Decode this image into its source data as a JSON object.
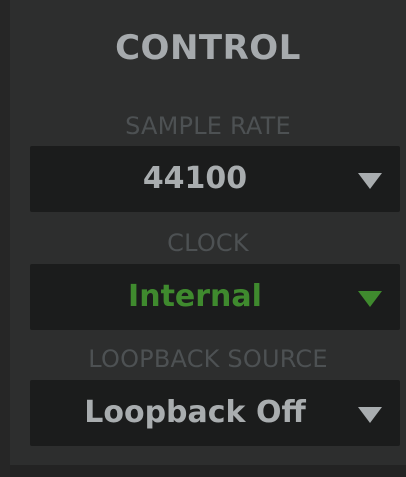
{
  "control": {
    "title": "CONTROL",
    "sample_rate": {
      "label": "SAMPLE RATE",
      "value": "44100",
      "value_color": "#a9adaf",
      "arrow_icon": "triangle-down"
    },
    "clock": {
      "label": "CLOCK",
      "value": "Internal",
      "value_color": "#3f8a2e",
      "arrow_icon": "triangle-down"
    },
    "loopback_source": {
      "label": "LOOPBACK SOURCE",
      "value": "Loopback Off",
      "value_color": "#a9adaf",
      "arrow_icon": "triangle-down"
    }
  }
}
